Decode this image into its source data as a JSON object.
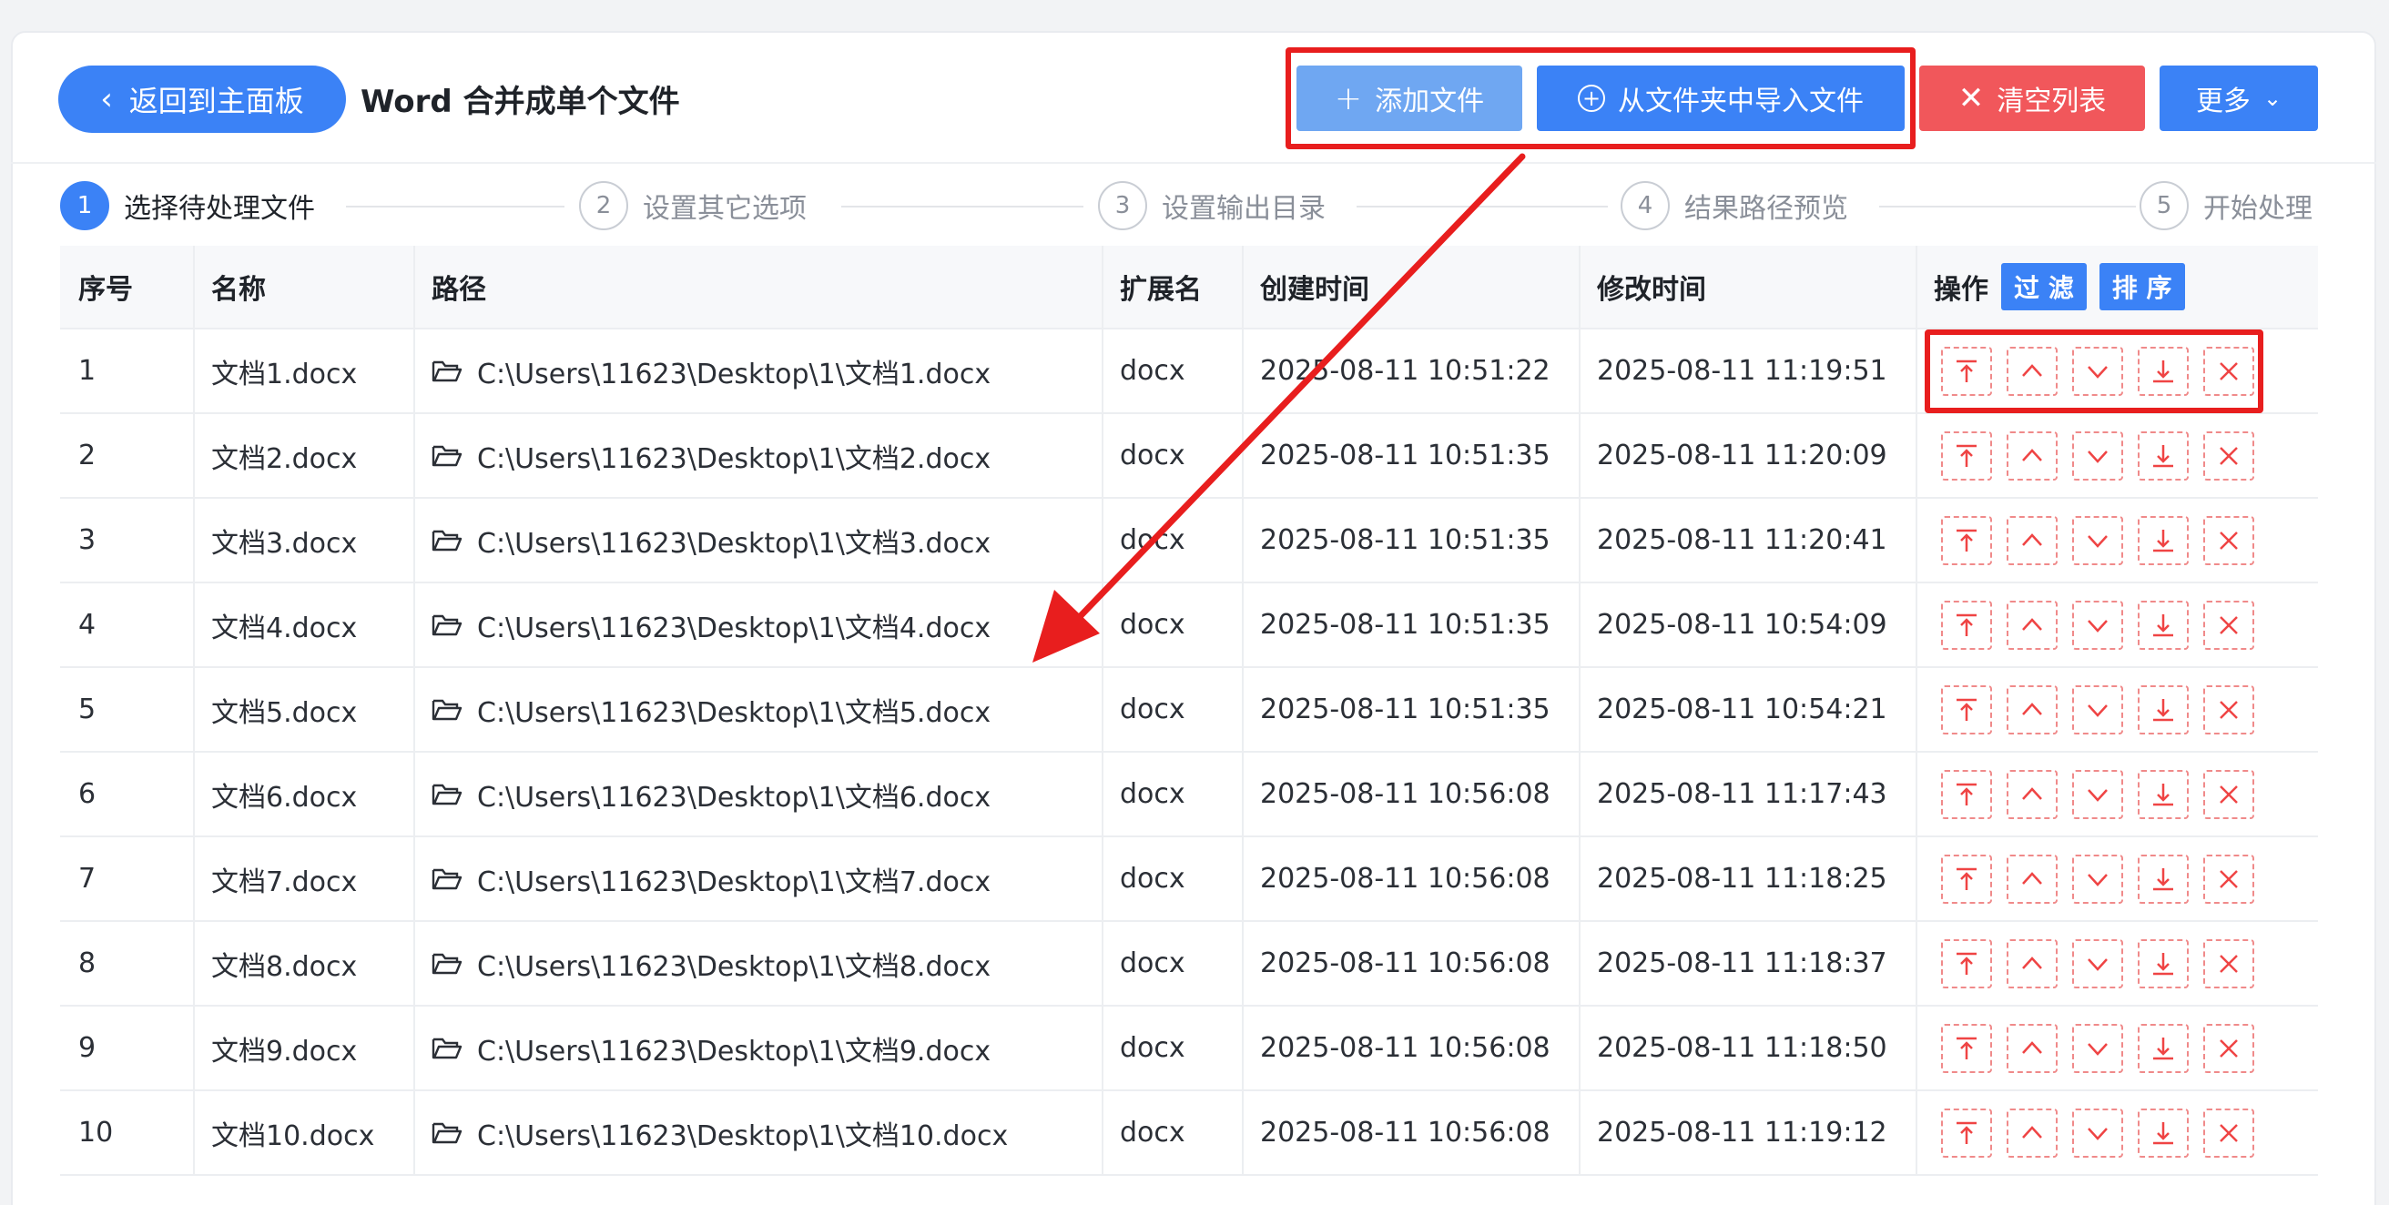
{
  "header": {
    "back_label": "返回到主面板",
    "title": "Word 合并成单个文件",
    "add_file_label": "添加文件",
    "import_folder_label": "从文件夹中导入文件",
    "clear_list_label": "清空列表",
    "more_label": "更多"
  },
  "steps": [
    {
      "num": "1",
      "label": "选择待处理文件"
    },
    {
      "num": "2",
      "label": "设置其它选项"
    },
    {
      "num": "3",
      "label": "设置输出目录"
    },
    {
      "num": "4",
      "label": "结果路径预览"
    },
    {
      "num": "5",
      "label": "开始处理"
    }
  ],
  "table": {
    "headers": {
      "index": "序号",
      "name": "名称",
      "path": "路径",
      "ext": "扩展名",
      "created": "创建时间",
      "modified": "修改时间",
      "ops": "操作",
      "filter": "过 滤",
      "sort": "排 序"
    },
    "rows": [
      {
        "index": "1",
        "name": "文档1.docx",
        "path": "C:\\Users\\11623\\Desktop\\1\\文档1.docx",
        "ext": "docx",
        "created": "2025-08-11 10:51:22",
        "modified": "2025-08-11 11:19:51"
      },
      {
        "index": "2",
        "name": "文档2.docx",
        "path": "C:\\Users\\11623\\Desktop\\1\\文档2.docx",
        "ext": "docx",
        "created": "2025-08-11 10:51:35",
        "modified": "2025-08-11 11:20:09"
      },
      {
        "index": "3",
        "name": "文档3.docx",
        "path": "C:\\Users\\11623\\Desktop\\1\\文档3.docx",
        "ext": "docx",
        "created": "2025-08-11 10:51:35",
        "modified": "2025-08-11 11:20:41"
      },
      {
        "index": "4",
        "name": "文档4.docx",
        "path": "C:\\Users\\11623\\Desktop\\1\\文档4.docx",
        "ext": "docx",
        "created": "2025-08-11 10:51:35",
        "modified": "2025-08-11 10:54:09"
      },
      {
        "index": "5",
        "name": "文档5.docx",
        "path": "C:\\Users\\11623\\Desktop\\1\\文档5.docx",
        "ext": "docx",
        "created": "2025-08-11 10:51:35",
        "modified": "2025-08-11 10:54:21"
      },
      {
        "index": "6",
        "name": "文档6.docx",
        "path": "C:\\Users\\11623\\Desktop\\1\\文档6.docx",
        "ext": "docx",
        "created": "2025-08-11 10:56:08",
        "modified": "2025-08-11 11:17:43"
      },
      {
        "index": "7",
        "name": "文档7.docx",
        "path": "C:\\Users\\11623\\Desktop\\1\\文档7.docx",
        "ext": "docx",
        "created": "2025-08-11 10:56:08",
        "modified": "2025-08-11 11:18:25"
      },
      {
        "index": "8",
        "name": "文档8.docx",
        "path": "C:\\Users\\11623\\Desktop\\1\\文档8.docx",
        "ext": "docx",
        "created": "2025-08-11 10:56:08",
        "modified": "2025-08-11 11:18:37"
      },
      {
        "index": "9",
        "name": "文档9.docx",
        "path": "C:\\Users\\11623\\Desktop\\1\\文档9.docx",
        "ext": "docx",
        "created": "2025-08-11 10:56:08",
        "modified": "2025-08-11 11:18:50"
      },
      {
        "index": "10",
        "name": "文档10.docx",
        "path": "C:\\Users\\11623\\Desktop\\1\\文档10.docx",
        "ext": "docx",
        "created": "2025-08-11 10:56:08",
        "modified": "2025-08-11 11:19:12"
      }
    ]
  },
  "row_actions": [
    "move-to-top-icon",
    "move-up-icon",
    "move-down-icon",
    "move-to-bottom-icon",
    "remove-icon"
  ],
  "colors": {
    "primary": "#3b82f6",
    "primary_light": "#6fa7f2",
    "danger": "#f1575b",
    "annotation_red": "#e81e1e"
  }
}
